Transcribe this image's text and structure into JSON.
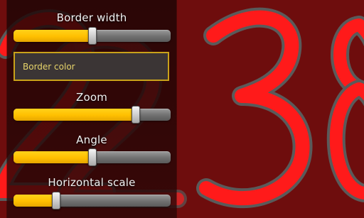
{
  "background": {
    "digits": "2238",
    "colors": {
      "base": "#6e0d0d",
      "digit_stroke": "#ff1a1a",
      "digit_outline": "#5a5a5a"
    }
  },
  "panel": {
    "sliders": [
      {
        "id": "border-width",
        "label": "Border width",
        "value": 0.5
      },
      {
        "id": "zoom",
        "label": "Zoom",
        "value": 0.78
      },
      {
        "id": "angle",
        "label": "Angle",
        "value": 0.5
      },
      {
        "id": "horizontal-scale",
        "label": "Horizontal scale",
        "value": 0.27
      }
    ],
    "border_color": {
      "label": "Border color"
    },
    "colors": {
      "fill": "#ffc000",
      "track": "#7a7a7a",
      "field_border": "#c9a21a",
      "field_text": "#e6d36a"
    }
  }
}
